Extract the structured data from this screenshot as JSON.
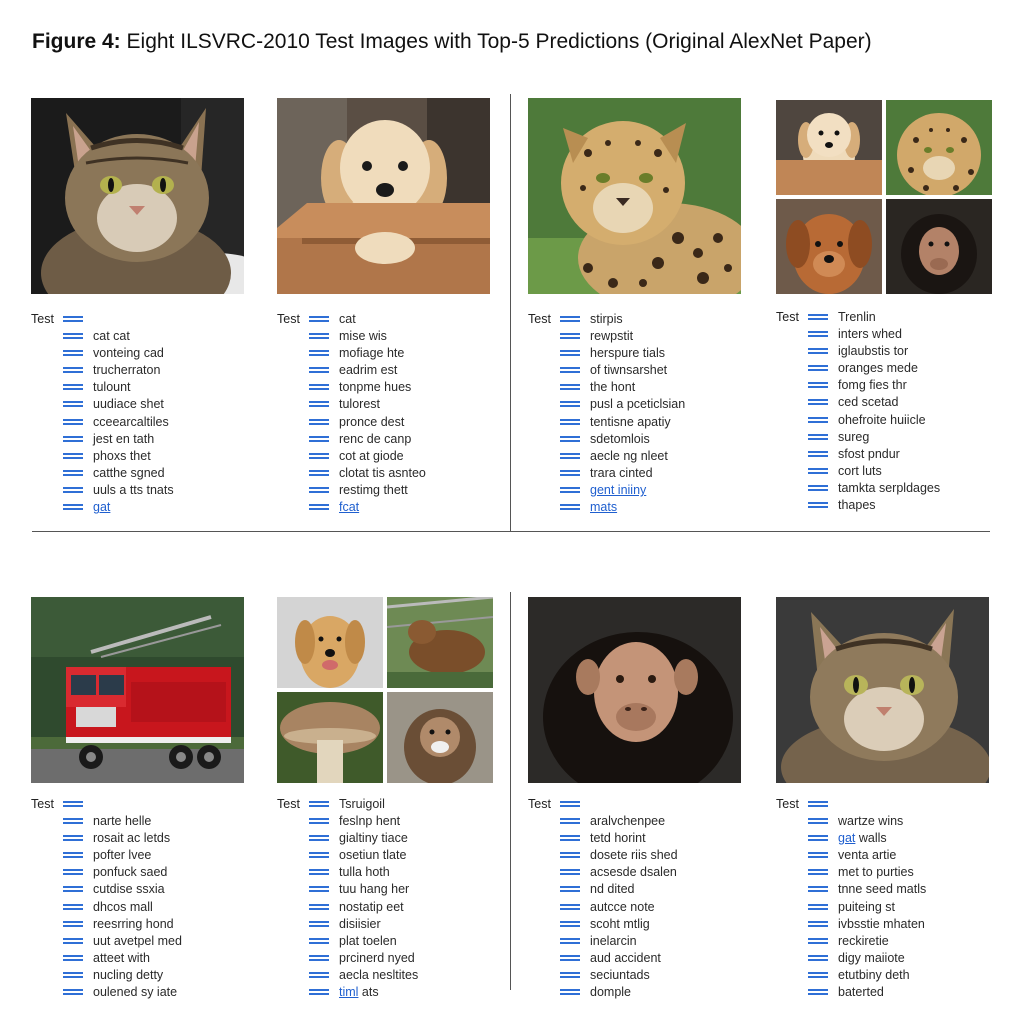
{
  "figure": {
    "label": "Figure 4:",
    "caption": "Eight ILSVRC-2010 Test Images with Top-5 Predictions (Original AlexNet Paper)"
  },
  "accent_color": "#2f6fd6",
  "panels": [
    {
      "test_label": "Test",
      "test_value": "",
      "image": "tabby-cat-photo",
      "predictions": [
        {
          "text": "cat cat",
          "highlight": false
        },
        {
          "text": "vonteing cad",
          "highlight": false
        },
        {
          "text": "trucherraton",
          "highlight": false
        },
        {
          "text": "tulount",
          "highlight": false
        },
        {
          "text": "uudiace shet",
          "highlight": false
        },
        {
          "text": "cceearcaltiles",
          "highlight": false
        },
        {
          "text": "jest en tath",
          "highlight": false
        },
        {
          "text": "phoxs thet",
          "highlight": false
        },
        {
          "text": "catthe sgned",
          "highlight": false
        },
        {
          "text": "uuls a tts tnats",
          "highlight": false
        },
        {
          "text": "gat",
          "highlight": true
        }
      ]
    },
    {
      "test_label": "Test",
      "test_value": "cat",
      "image": "puppy-in-box-photo",
      "predictions": [
        {
          "text": "mise wis",
          "highlight": false
        },
        {
          "text": "mofiage hte",
          "highlight": false
        },
        {
          "text": "eadrim est",
          "highlight": false
        },
        {
          "text": "tonpme hues",
          "highlight": false
        },
        {
          "text": "tulorest",
          "highlight": false
        },
        {
          "text": "pronce dest",
          "highlight": false
        },
        {
          "text": "renc de canp",
          "highlight": false
        },
        {
          "text": "cot at giode",
          "highlight": false
        },
        {
          "text": "clotat tis asnteo",
          "highlight": false
        },
        {
          "text": "restimg thett",
          "highlight": false
        },
        {
          "text": "fcat",
          "highlight": true
        }
      ]
    },
    {
      "test_label": "Test",
      "test_value": "stirpis",
      "image": "leopard-photo",
      "predictions": [
        {
          "text": "rewpstit",
          "highlight": false
        },
        {
          "text": "herspure tials",
          "highlight": false
        },
        {
          "text": "of tiwnsarshet",
          "highlight": false
        },
        {
          "text": "the hont",
          "highlight": false
        },
        {
          "text": "pusl a pceticlsian",
          "highlight": false
        },
        {
          "text": "tentisne apatiy",
          "highlight": false
        },
        {
          "text": "sdetomlois",
          "highlight": false
        },
        {
          "text": "aecle ng nleet",
          "highlight": false
        },
        {
          "text": "trara cinted",
          "highlight": false
        },
        {
          "text": "gent iniiny",
          "highlight": true
        },
        {
          "text": "mats",
          "highlight": true
        }
      ]
    },
    {
      "test_label": "Test",
      "test_value": "Trenlin",
      "image": "four-animal-grid",
      "predictions": [
        {
          "text": "inters whed",
          "highlight": false
        },
        {
          "text": "iglaubstis tor",
          "highlight": false
        },
        {
          "text": "oranges mede",
          "highlight": false
        },
        {
          "text": "fomg fies thr",
          "highlight": false
        },
        {
          "text": "ced scetad",
          "highlight": false
        },
        {
          "text": "ohefroite huiicle",
          "highlight": false
        },
        {
          "text": "sureg",
          "highlight": false
        },
        {
          "text": "sfost pndur",
          "highlight": false
        },
        {
          "text": "cort luts",
          "highlight": false
        },
        {
          "text": "tamkta serpldages",
          "highlight": false
        },
        {
          "text": "thapes",
          "highlight": false
        }
      ]
    },
    {
      "test_label": "Test",
      "test_value": "",
      "image": "fire-truck-photo",
      "predictions": [
        {
          "text": "narte helle",
          "highlight": false
        },
        {
          "text": "rosait ac letds",
          "highlight": false
        },
        {
          "text": "pofter lvee",
          "highlight": false
        },
        {
          "text": "ponfuck saed",
          "highlight": false
        },
        {
          "text": "cutdise ssxia",
          "highlight": false
        },
        {
          "text": "dhcos mall",
          "highlight": false
        },
        {
          "text": "reesrring hond",
          "highlight": false
        },
        {
          "text": "uut avetpel med",
          "highlight": false
        },
        {
          "text": "atteet with",
          "highlight": false
        },
        {
          "text": "nucling detty",
          "highlight": false
        },
        {
          "text": "oulened sy iate",
          "highlight": false
        }
      ]
    },
    {
      "test_label": "Test",
      "test_value": "Tsruigoil",
      "image": "dog-mushroom-monkey-grid",
      "predictions": [
        {
          "text": "feslnp hent",
          "highlight": false
        },
        {
          "text": "gialtiny tiace",
          "highlight": false
        },
        {
          "text": "osetiun tlate",
          "highlight": false
        },
        {
          "text": "tulla hoth",
          "highlight": false
        },
        {
          "text": "tuu hang her",
          "highlight": false
        },
        {
          "text": "nostatip eet",
          "highlight": false
        },
        {
          "text": "disiisier",
          "highlight": false
        },
        {
          "text": "plat toelen",
          "highlight": false
        },
        {
          "text": "prcinerd nyed",
          "highlight": false
        },
        {
          "text": "aecla nesltites",
          "highlight": false
        },
        {
          "text": "timl ats",
          "highlight": false,
          "highlight_prefix": "timl",
          "rest": " ats"
        }
      ]
    },
    {
      "test_label": "Test",
      "test_value": "",
      "image": "chimpanzee-photo",
      "predictions": [
        {
          "text": "aralvchenpee",
          "highlight": false
        },
        {
          "text": "tetd horint",
          "highlight": false
        },
        {
          "text": "dosete riis shed",
          "highlight": false
        },
        {
          "text": "acsesde dsalen",
          "highlight": false
        },
        {
          "text": "nd dited",
          "highlight": false
        },
        {
          "text": "autcce note",
          "highlight": false
        },
        {
          "text": "scoht mtlig",
          "highlight": false
        },
        {
          "text": "inelarcin",
          "highlight": false
        },
        {
          "text": "aud accident",
          "highlight": false
        },
        {
          "text": "seciuntads",
          "highlight": false
        },
        {
          "text": "domple",
          "highlight": false
        }
      ]
    },
    {
      "test_label": "Test",
      "test_value": "",
      "image": "tabby-cat-photo-2",
      "predictions": [
        {
          "text": "wartze wins",
          "highlight": false
        },
        {
          "text": "walls",
          "highlight": false,
          "highlight_prefix": "gat",
          "rest": " walls"
        },
        {
          "text": "venta artie",
          "highlight": false
        },
        {
          "text": "met to purties",
          "highlight": false
        },
        {
          "text": "tnne seed matls",
          "highlight": false
        },
        {
          "text": "puiteing st",
          "highlight": false
        },
        {
          "text": "ivbsstie mhaten",
          "highlight": false
        },
        {
          "text": "reckiretie",
          "highlight": false
        },
        {
          "text": "digy maiiote",
          "highlight": false
        },
        {
          "text": "etutbiny deth",
          "highlight": false
        },
        {
          "text": "baterted",
          "highlight": false
        }
      ]
    }
  ]
}
